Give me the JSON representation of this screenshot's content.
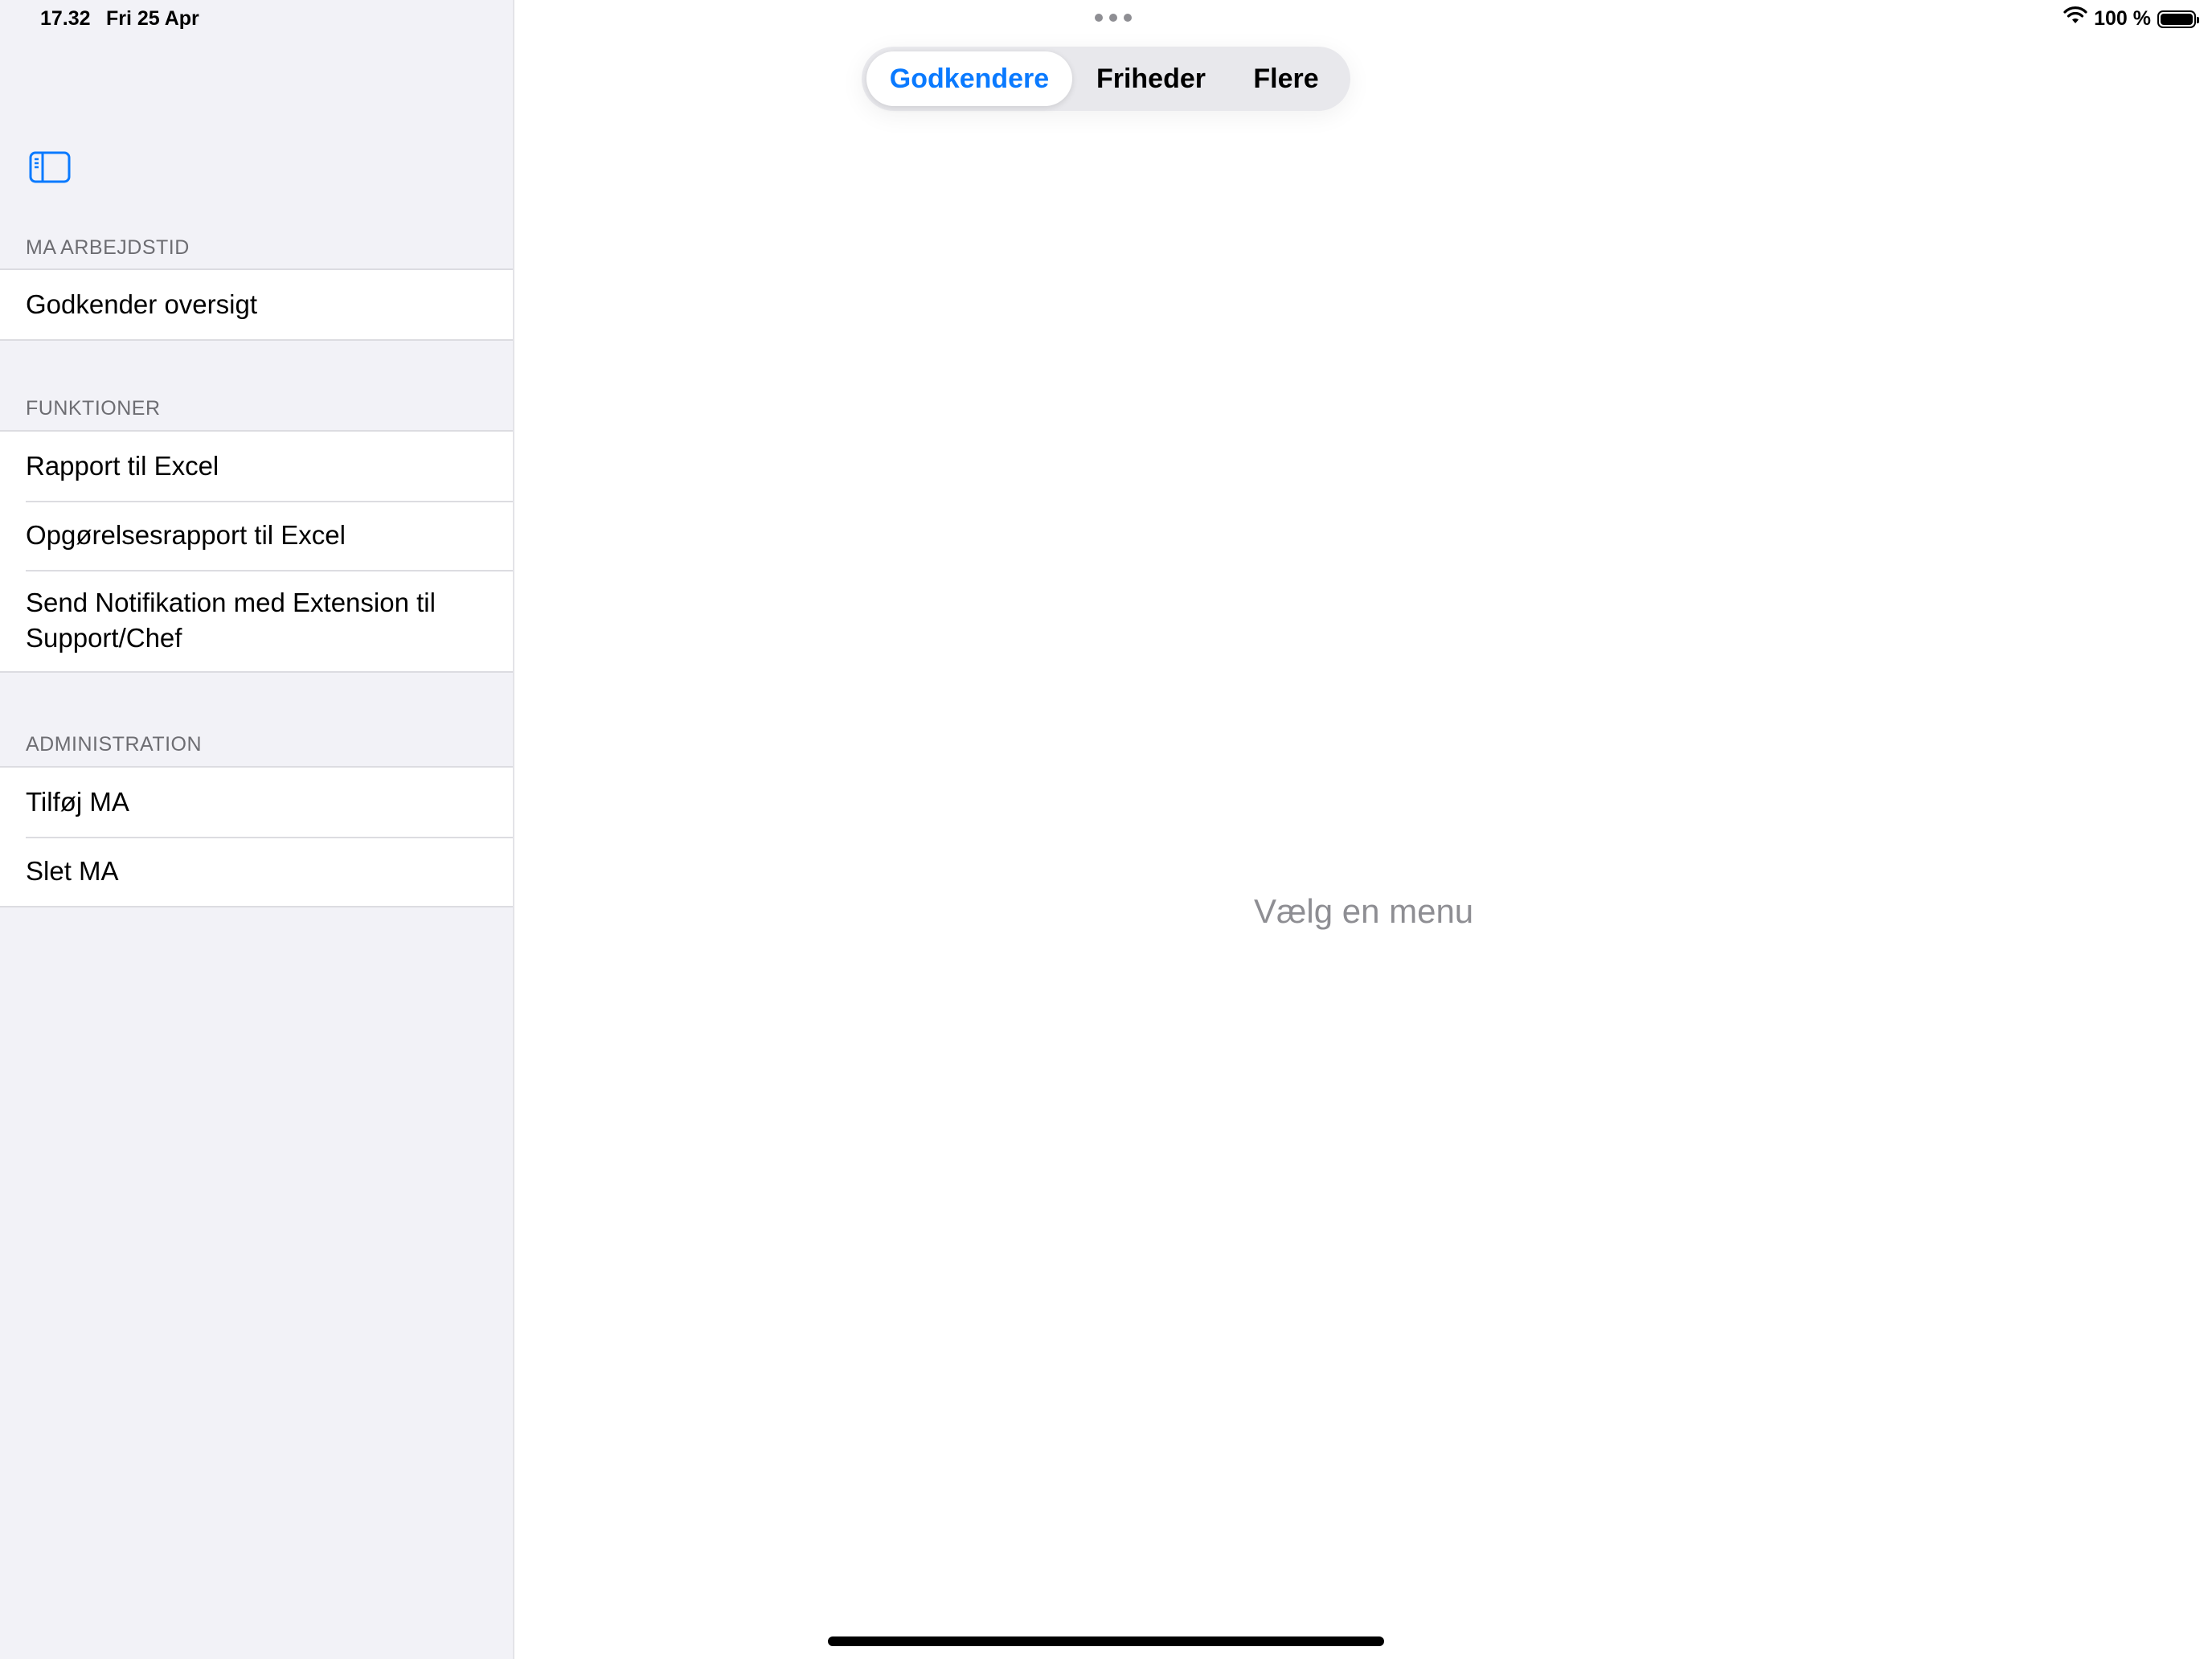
{
  "status_bar": {
    "time": "17.32",
    "date": "Fri 25 Apr",
    "battery_percent": "100 %",
    "battery_level": 1.0,
    "icons": [
      "wifi-icon",
      "battery-icon",
      "multitasking-dots-icon"
    ]
  },
  "sidebar": {
    "toggle_icon": "sidebar-toggle-icon",
    "sections": [
      {
        "header": "MA ARBEJDSTID",
        "items": [
          {
            "label": "Godkender oversigt"
          }
        ]
      },
      {
        "header": "FUNKTIONER",
        "items": [
          {
            "label": "Rapport til Excel"
          },
          {
            "label": "Opgørelsesrapport til Excel"
          },
          {
            "label": "Send Notifikation med Extension til Support/Chef"
          }
        ]
      },
      {
        "header": "ADMINISTRATION",
        "items": [
          {
            "label": "Tilføj MA"
          },
          {
            "label": "Slet MA"
          }
        ]
      }
    ]
  },
  "tabs": {
    "items": [
      {
        "label": "Godkendere",
        "selected": true
      },
      {
        "label": "Friheder",
        "selected": false
      },
      {
        "label": "Flere",
        "selected": false
      }
    ]
  },
  "main": {
    "placeholder": "Vælg en menu"
  },
  "colors": {
    "accent": "#0a7aff",
    "sidebar_bg": "#f2f2f7",
    "secondary_text": "#8e8e93"
  }
}
